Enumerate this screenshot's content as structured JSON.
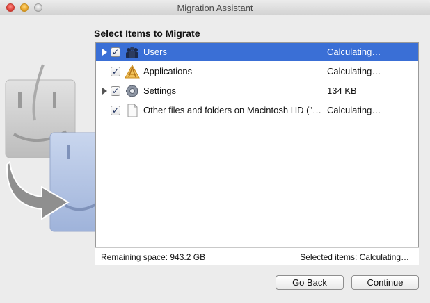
{
  "window": {
    "title": "Migration Assistant"
  },
  "heading": "Select Items to Migrate",
  "items": [
    {
      "label": "Users",
      "size": "Calculating…",
      "checked": true,
      "expandable": true,
      "selected": true,
      "icon": "users-icon"
    },
    {
      "label": "Applications",
      "size": "Calculating…",
      "checked": true,
      "expandable": false,
      "selected": false,
      "icon": "applications-icon"
    },
    {
      "label": "Settings",
      "size": "134 KB",
      "checked": true,
      "expandable": true,
      "selected": false,
      "icon": "settings-gear-icon"
    },
    {
      "label": "Other files and folders on Macintosh HD (\"…",
      "size": "Calculating…",
      "checked": true,
      "expandable": false,
      "selected": false,
      "icon": "document-icon"
    }
  ],
  "status": {
    "remaining_space": "Remaining space: 943.2 GB",
    "selected_items": "Selected items: Calculating…"
  },
  "buttons": {
    "back": "Go Back",
    "continue": "Continue"
  },
  "colors": {
    "selection": "#3a6fd6",
    "window_bg": "#ececec"
  }
}
